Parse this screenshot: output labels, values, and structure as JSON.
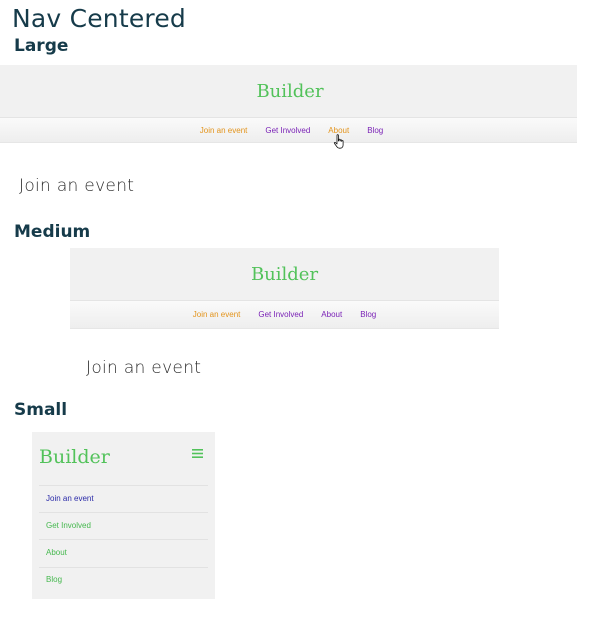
{
  "page": {
    "title": "Nav Centered"
  },
  "sections": {
    "large": "Large",
    "medium": "Medium",
    "small": "Small"
  },
  "brand": "Builder",
  "nav": {
    "items": [
      "Join an event",
      "Get Involved",
      "About",
      "Blog"
    ]
  },
  "content": {
    "heading": "Join an event"
  },
  "menu_icon": "hamburger-menu-icon",
  "colors": {
    "brand_green": "#52c25a",
    "active_orange": "#e3941c",
    "visited_purple": "#7a22b6",
    "small_link_navy": "#2a2aa8",
    "small_link_green": "#45b84e",
    "heading_teal": "#163b4a"
  }
}
